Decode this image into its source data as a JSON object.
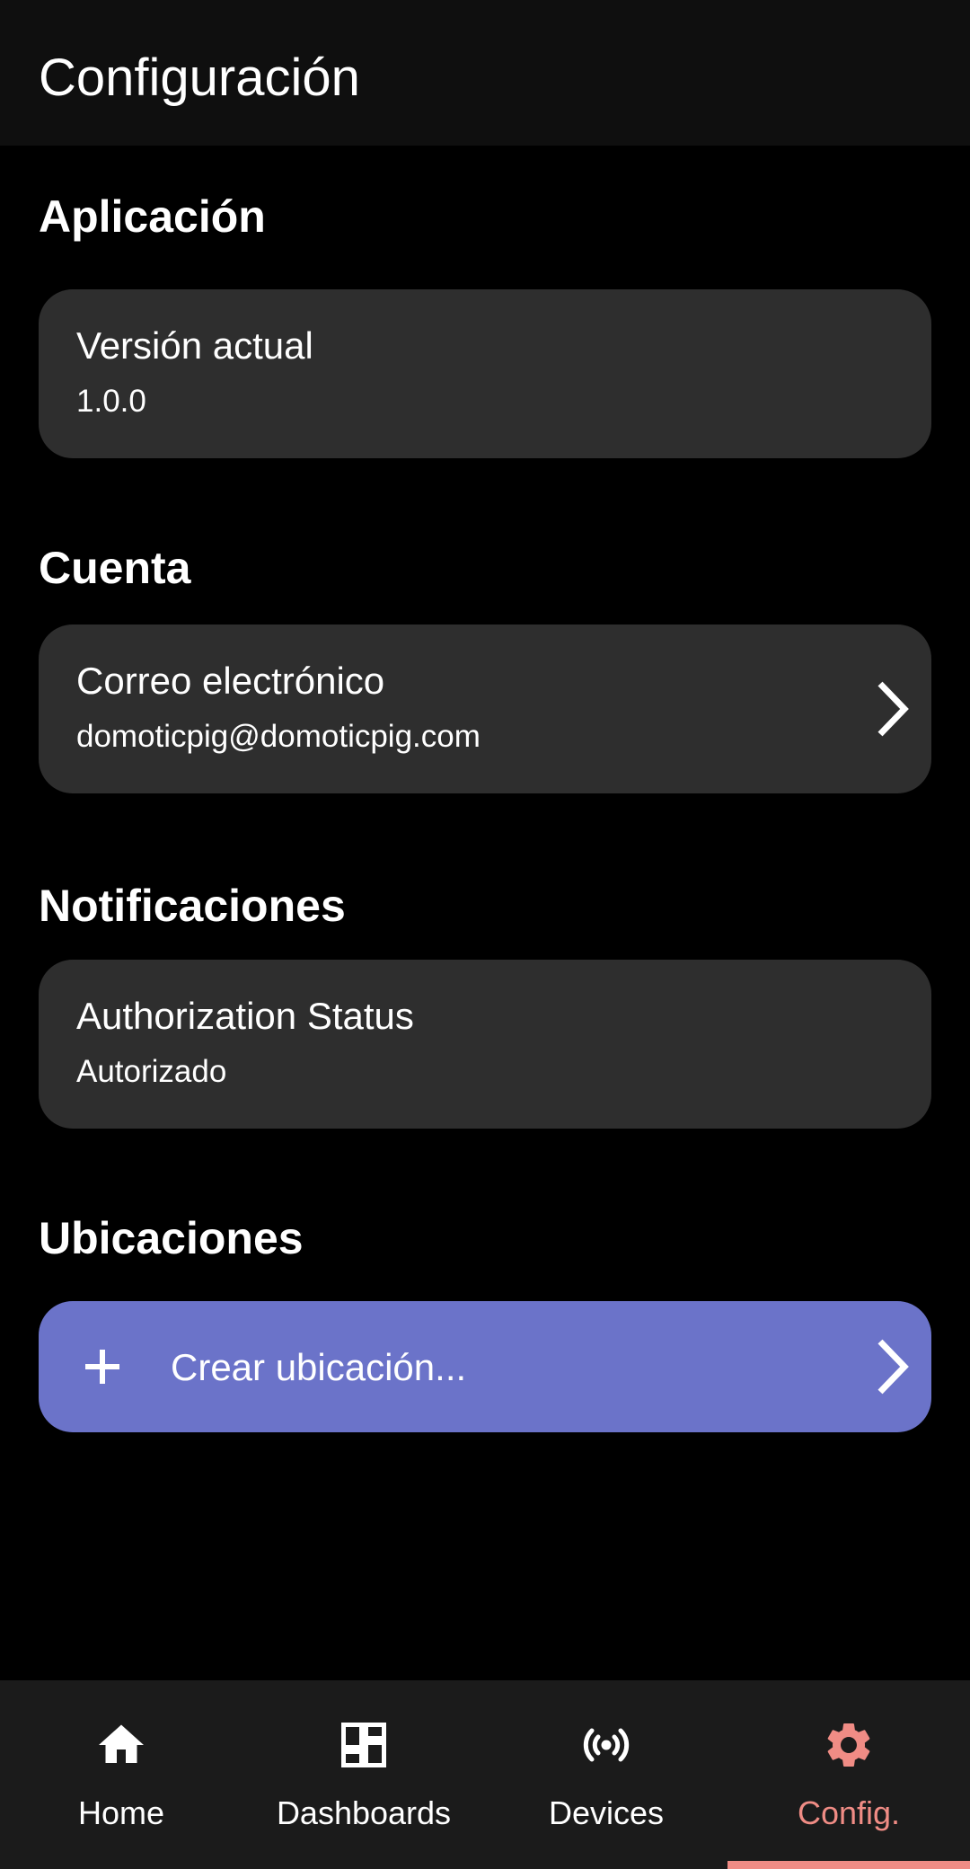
{
  "app_bar": {
    "title": "Configuración"
  },
  "sections": [
    {
      "title": "Aplicación",
      "item": {
        "title": "Versión actual",
        "subtitle": "1.0.0"
      }
    },
    {
      "title": "Cuenta",
      "item": {
        "title": "Correo electrónico",
        "subtitle": "domoticpig@domoticpig.com",
        "icon": "chevron-right-icon"
      }
    },
    {
      "title": "Notificaciones",
      "item": {
        "title": "Authorization Status",
        "subtitle": "Autorizado"
      }
    },
    {
      "title": "Ubicaciones",
      "action": {
        "label": "Crear ubicación...",
        "icon": "plus-icon",
        "trailing_icon": "chevron-right-icon"
      }
    }
  ],
  "bottom_nav": {
    "items": [
      {
        "label": "Home",
        "icon": "home-icon",
        "active": false
      },
      {
        "label": "Dashboards",
        "icon": "dashboard-icon",
        "active": false
      },
      {
        "label": "Devices",
        "icon": "broadcast-icon",
        "active": false
      },
      {
        "label": "Config.",
        "icon": "gear-icon",
        "active": true
      }
    ]
  },
  "colors": {
    "background": "#000000",
    "app_bar": "#0f0f0f",
    "card": "#2e2e2e",
    "action": "#6b73c9",
    "nav": "#1b1b1b",
    "accent": "#f08c85",
    "text": "#ffffff"
  }
}
